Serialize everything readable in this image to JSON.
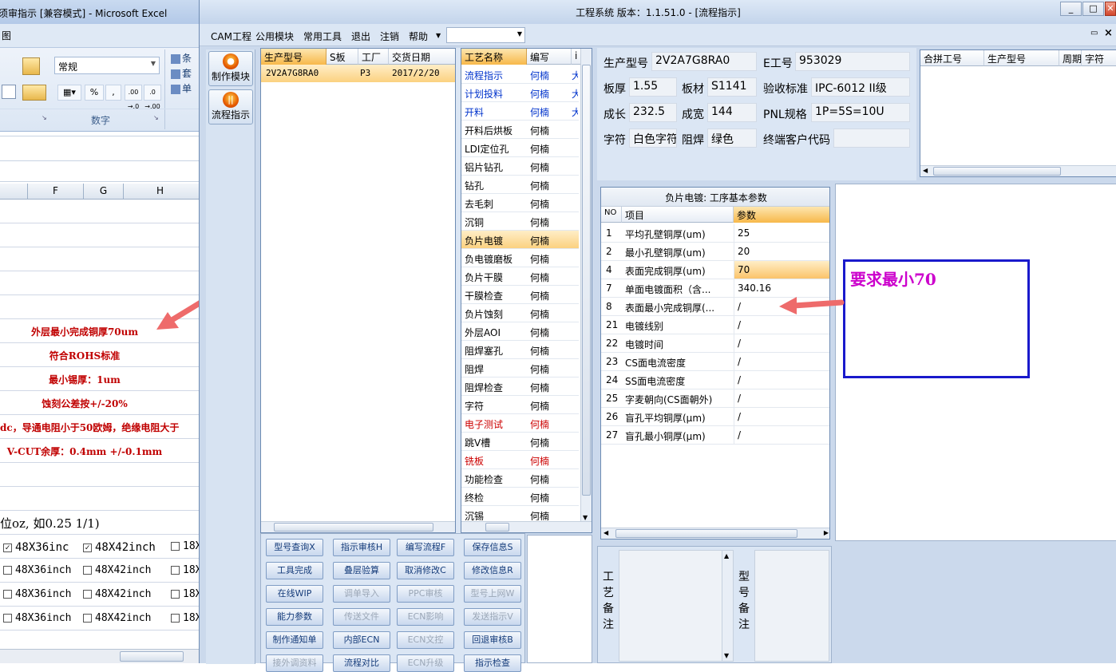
{
  "excel": {
    "title": "须审指示 [兼容模式] - Microsoft Excel",
    "menu_first": "图",
    "format_select": "常规",
    "number_group_label": "数字",
    "percent": "%",
    "comma": ",",
    "dec_inc": ".00 →.0",
    "dec_dec": ".0 →.00",
    "ribbon_right": [
      "条",
      "套",
      "单"
    ],
    "columns": [
      "F",
      "G",
      "H"
    ],
    "rows_text": [
      "外层最小完成铜厚70um",
      "符合ROHS标准",
      "最小锡厚：1um",
      "蚀刻公差按+/-20%",
      "dc，导通电阻小于50欧姆，绝缘电阻大于",
      "V-CUT余厚：0.4mm +/-0.1mm"
    ],
    "unit_line": "位oz, 如0.25 1/1)",
    "check_rows": [
      {
        "a": "48X36inc",
        "b": "48X42inch",
        "c": "18X",
        "checked": true
      },
      {
        "a": "48X36inch",
        "b": "48X42inch",
        "c": "18X",
        "checked": false
      },
      {
        "a": "48X36inch",
        "b": "48X42inch",
        "c": "18X",
        "checked": false
      },
      {
        "a": "48X36inch",
        "b": "48X42inch",
        "c": "18X",
        "checked": false
      }
    ]
  },
  "window": {
    "title": "工程系统  版本：1.1.51.0 - [流程指示]",
    "menu": [
      "CAM工程",
      "公用模块",
      "常用工具",
      "退出",
      "注销",
      "帮助"
    ],
    "min": "_",
    "max": "□",
    "close": "✕",
    "toolbar": [
      {
        "label": "制作模块",
        "icon": "flame-icon"
      },
      {
        "label": "流程指示",
        "icon": "flame-icon"
      }
    ]
  },
  "orders": {
    "headers": [
      "生产型号",
      "S板",
      "工厂",
      "交货日期"
    ],
    "rows": [
      {
        "model": "2V2A7G8RA0",
        "s": "",
        "factory": "P3",
        "date": "2017/2/20"
      }
    ]
  },
  "process": {
    "headers": [
      "工艺名称",
      "编写",
      "i"
    ],
    "rows": [
      {
        "name": "流程指示",
        "writer": "何楠",
        "c": "大",
        "color": "#0033cc"
      },
      {
        "name": "计划投料",
        "writer": "何楠",
        "c": "大",
        "color": "#0033cc"
      },
      {
        "name": "开料",
        "writer": "何楠",
        "c": "大",
        "color": "#0033cc"
      },
      {
        "name": "开料后烘板",
        "writer": "何楠",
        "c": "",
        "color": "#000000"
      },
      {
        "name": "LDI定位孔",
        "writer": "何楠",
        "c": "",
        "color": "#000000"
      },
      {
        "name": "铝片钻孔",
        "writer": "何楠",
        "c": "",
        "color": "#000000"
      },
      {
        "name": "钻孔",
        "writer": "何楠",
        "c": "",
        "color": "#000000"
      },
      {
        "name": "去毛刺",
        "writer": "何楠",
        "c": "",
        "color": "#000000"
      },
      {
        "name": "沉铜",
        "writer": "何楠",
        "c": "",
        "color": "#000000"
      },
      {
        "name": "负片电镀",
        "writer": "何楠",
        "c": "",
        "color": "#000000"
      },
      {
        "name": "负电镀磨板",
        "writer": "何楠",
        "c": "",
        "color": "#000000"
      },
      {
        "name": "负片干膜",
        "writer": "何楠",
        "c": "",
        "color": "#000000"
      },
      {
        "name": "干膜检查",
        "writer": "何楠",
        "c": "",
        "color": "#000000"
      },
      {
        "name": "负片蚀刻",
        "writer": "何楠",
        "c": "",
        "color": "#000000"
      },
      {
        "name": "外层AOI",
        "writer": "何楠",
        "c": "",
        "color": "#000000"
      },
      {
        "name": "阻焊塞孔",
        "writer": "何楠",
        "c": "",
        "color": "#000000"
      },
      {
        "name": "阻焊",
        "writer": "何楠",
        "c": "",
        "color": "#000000"
      },
      {
        "name": "阻焊检查",
        "writer": "何楠",
        "c": "",
        "color": "#000000"
      },
      {
        "name": "字符",
        "writer": "何楠",
        "c": "",
        "color": "#000000"
      },
      {
        "name": "电子测试",
        "writer": "何楠",
        "c": "",
        "color": "#cc0000"
      },
      {
        "name": "跳V槽",
        "writer": "何楠",
        "c": "",
        "color": "#000000"
      },
      {
        "name": "铣板",
        "writer": "何楠",
        "c": "",
        "color": "#cc0000"
      },
      {
        "name": "功能检查",
        "writer": "何楠",
        "c": "",
        "color": "#000000"
      },
      {
        "name": "终检",
        "writer": "何楠",
        "c": "",
        "color": "#000000"
      },
      {
        "name": "沉锡",
        "writer": "何楠",
        "c": "",
        "color": "#000000"
      }
    ],
    "selected_index": 9
  },
  "info": {
    "model_label": "生产型号",
    "model": "2V2A7G8RA0",
    "e_label": "E工号",
    "e": "953029",
    "thick_label": "板厚",
    "thick": "1.55",
    "mat_label": "板材",
    "mat": "S1141",
    "std_label": "验收标准",
    "std": "IPC-6012 II级",
    "len_label": "成长",
    "len": "232.5",
    "wid_label": "成宽",
    "wid": "144",
    "pnl_label": "PNL规格",
    "pnl": "1P=5S=10U",
    "char_label": "字符",
    "char": "白色字符",
    "mask_label": "阻焊",
    "mask": "绿色",
    "cust_label": "终端客户代码",
    "cust": ""
  },
  "merge": {
    "headers": [
      "合拼工号",
      "生产型号",
      "周期",
      "字符"
    ]
  },
  "params": {
    "title": "负片电镀: 工序基本参数",
    "headers": [
      "NO",
      "项目",
      "参数"
    ],
    "rows": [
      {
        "no": "1",
        "item": "平均孔壁铜厚(um)",
        "val": "25"
      },
      {
        "no": "2",
        "item": "最小孔壁铜厚(um)",
        "val": "20"
      },
      {
        "no": "4",
        "item": "表面完成铜厚(um)",
        "val": "70"
      },
      {
        "no": "7",
        "item": "单面电镀面积（含...",
        "val": "340.16"
      },
      {
        "no": "8",
        "item": "表面最小完成铜厚(...",
        "val": "/"
      },
      {
        "no": "21",
        "item": "电镀线别",
        "val": "/"
      },
      {
        "no": "22",
        "item": "电镀时间",
        "val": "/"
      },
      {
        "no": "23",
        "item": "CS面电流密度",
        "val": "/"
      },
      {
        "no": "24",
        "item": "SS面电流密度",
        "val": "/"
      },
      {
        "no": "25",
        "item": "字麦朝向(CS面朝外)",
        "val": "/"
      },
      {
        "no": "26",
        "item": "盲孔平均铜厚(μm)",
        "val": "/"
      },
      {
        "no": "27",
        "item": "盲孔最小铜厚(μm)",
        "val": "/"
      }
    ],
    "highlight_index": 2
  },
  "annotation": {
    "text": "要求最小70",
    "color": "#cc00cc",
    "arrow_color": "#ee6b6b"
  },
  "buttons": [
    [
      "型号查询X",
      "指示审核H",
      "编写流程F",
      "保存信息S"
    ],
    [
      "工具完成",
      "叠层验算",
      "取消修改C",
      "修改信息R"
    ],
    [
      "在线WIP",
      "调单导入",
      "PPC审核",
      "型号上网W"
    ],
    [
      "能力参数",
      "传送文件",
      "ECN影响",
      "发送指示V"
    ],
    [
      "制作通知单",
      "内部ECN",
      "ECN文控",
      "回退审核B"
    ],
    [
      "接外调资料",
      "流程对比",
      "ECN升级",
      "指示检查"
    ]
  ],
  "disabled_buttons": [
    "调单导入",
    "PPC审核",
    "型号上网W",
    "传送文件",
    "ECN影响",
    "发送指示V",
    "ECN文控",
    "ECN升级",
    "接外调资料"
  ],
  "notes": {
    "process_note": "工艺备注",
    "model_note": "型号备注"
  }
}
